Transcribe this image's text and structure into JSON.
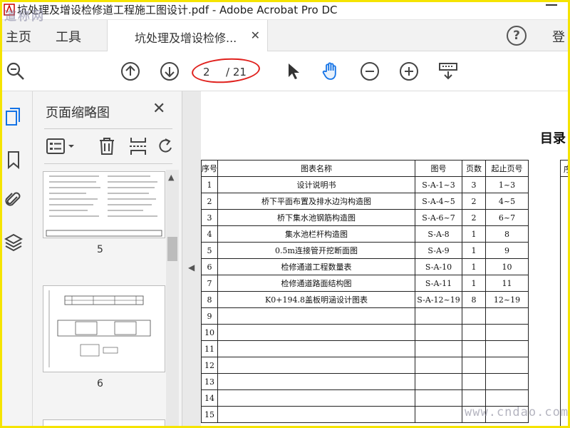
{
  "window": {
    "title": "坑处理及增设检修道工程施工图设计.pdf - Adobe Acrobat Pro DC",
    "watermark_top": "道称网",
    "watermark_bottom": "www.cndao.com"
  },
  "nav": {
    "home": "主页",
    "tools": "工具",
    "doc_tab": "坑处理及增设检修...",
    "login": "登"
  },
  "toolbar": {
    "current_page": "2",
    "total_pages": "/ 21",
    "highlight_color": "#e0211d"
  },
  "thumbnails": {
    "panel_title": "页面缩略图",
    "pages": [
      {
        "label": "5"
      },
      {
        "label": "6"
      }
    ]
  },
  "document": {
    "heading": "目录",
    "columns": [
      "序号",
      "图表名称",
      "图号",
      "页数",
      "起止页号"
    ],
    "rows": [
      [
        "1",
        "设计说明书",
        "S-A-1~3",
        "3",
        "1~3"
      ],
      [
        "2",
        "桥下平面布置及排水边沟构造图",
        "S-A-4~5",
        "2",
        "4~5"
      ],
      [
        "3",
        "桥下集水池钢筋构造图",
        "S-A-6~7",
        "2",
        "6~7"
      ],
      [
        "4",
        "集水池栏杆构造图",
        "S-A-8",
        "1",
        "8"
      ],
      [
        "5",
        "0.5m连接管开挖断面图",
        "S-A-9",
        "1",
        "9"
      ],
      [
        "6",
        "检修通道工程数量表",
        "S-A-10",
        "1",
        "10"
      ],
      [
        "7",
        "检修通道路面结构图",
        "S-A-11",
        "1",
        "11"
      ],
      [
        "8",
        "K0+194.8盖板明涵设计图表",
        "S-A-12~19",
        "8",
        "12~19"
      ],
      [
        "9",
        "",
        "",
        "",
        ""
      ],
      [
        "10",
        "",
        "",
        "",
        ""
      ],
      [
        "11",
        "",
        "",
        "",
        ""
      ],
      [
        "12",
        "",
        "",
        "",
        ""
      ],
      [
        "13",
        "",
        "",
        "",
        ""
      ],
      [
        "14",
        "",
        "",
        "",
        ""
      ],
      [
        "15",
        "",
        "",
        "",
        ""
      ]
    ],
    "side_column_header": "序"
  }
}
